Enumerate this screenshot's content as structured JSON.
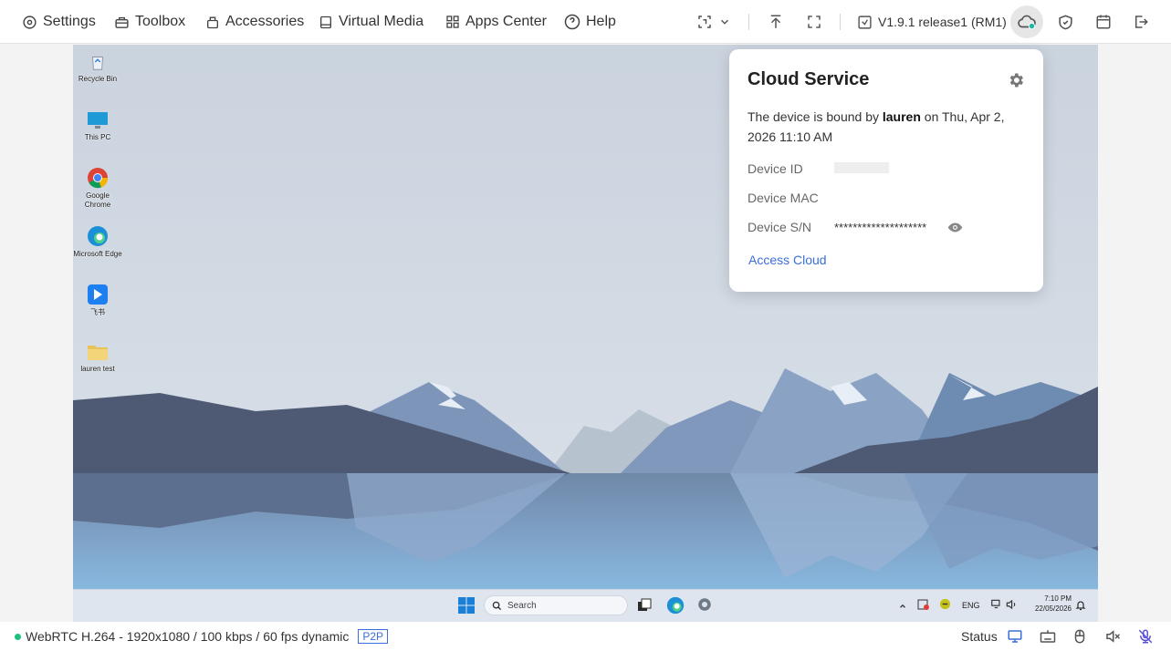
{
  "menu": [
    {
      "label": "Settings",
      "icon": "settings-icon"
    },
    {
      "label": "Toolbox",
      "icon": "toolbox-icon"
    },
    {
      "label": "Accessories",
      "icon": "accessories-icon"
    },
    {
      "label": "Virtual Media",
      "icon": "virtual-media-icon"
    },
    {
      "label": "Apps Center",
      "icon": "apps-center-icon"
    },
    {
      "label": "Help",
      "icon": "help-icon"
    }
  ],
  "version": "V1.9.1 release1 (RM1)",
  "desktop_icons": [
    {
      "label": "Recycle Bin",
      "icon": "recycle-bin-icon"
    },
    {
      "label": "This PC",
      "icon": "this-pc-icon"
    },
    {
      "label": "Google Chrome",
      "icon": "chrome-icon"
    },
    {
      "label": "Microsoft Edge",
      "icon": "edge-icon"
    },
    {
      "label": "飞书",
      "icon": "feishu-icon"
    },
    {
      "label": "lauren test",
      "icon": "folder-icon"
    }
  ],
  "taskbar": {
    "search_placeholder": "Search",
    "lang": "ENG",
    "time": "7:10 PM",
    "date": "22/05/2026"
  },
  "cloud_popup": {
    "title": "Cloud Service",
    "desc_prefix": "The device is bound by ",
    "user": "lauren",
    "desc_suffix": " on Thu, Apr 2, 2026 11:10 AM",
    "device_id_label": "Device ID",
    "device_mac_label": "Device MAC",
    "device_sn_label": "Device S/N",
    "device_sn_value": "********************",
    "link": "Access Cloud"
  },
  "status": {
    "connection": "WebRTC H.264 - 1920x1080 / 100 kbps / 60 fps dynamic",
    "p2p": "P2P",
    "label": "Status"
  },
  "colors": {
    "accent": "#3b6fd8",
    "online": "#19c37d",
    "cloud_status": "#1fb8a8"
  }
}
